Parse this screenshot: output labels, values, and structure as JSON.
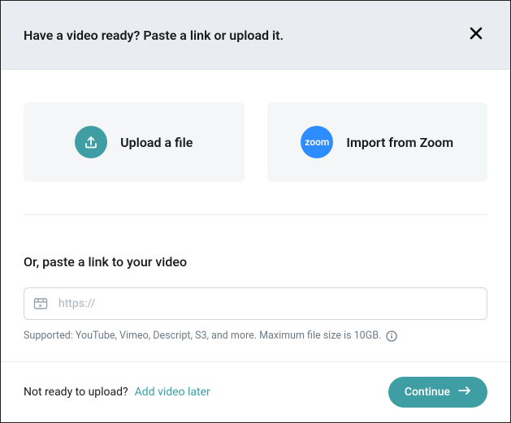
{
  "header": {
    "title": "Have a video ready? Paste a link or upload it."
  },
  "options": {
    "upload_label": "Upload a file",
    "zoom_label": "Import from Zoom",
    "zoom_icon_text": "zoom"
  },
  "paste": {
    "heading": "Or, paste a link to your video",
    "placeholder": "https://",
    "value": "",
    "support_text": "Supported: YouTube, Vimeo, Descript, S3, and more. Maximum file size is 10GB."
  },
  "footer": {
    "prompt": "Not ready to upload?",
    "link_label": "Add video later",
    "continue_label": "Continue"
  }
}
